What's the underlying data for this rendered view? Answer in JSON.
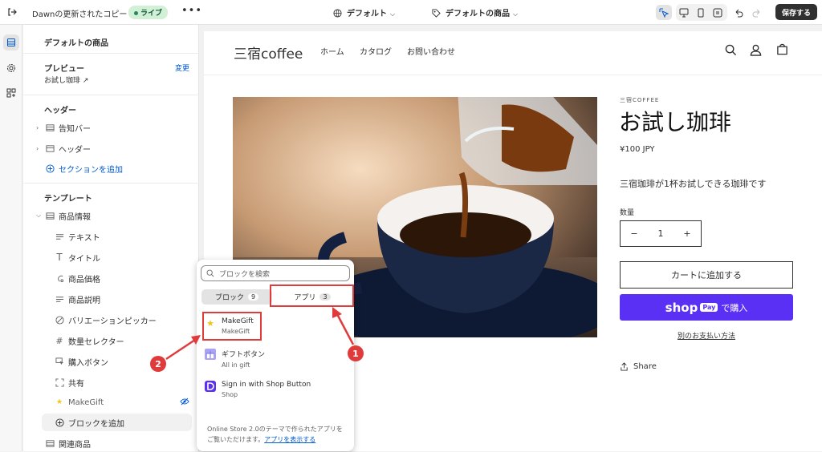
{
  "topbar": {
    "theme_name": "Dawnの更新されたコピー",
    "live_badge": "ライブ",
    "more_label": "•••",
    "template_select": "デフォルト",
    "product_select": "デフォルトの商品",
    "save_label": "保存する"
  },
  "sidebar": {
    "title": "デフォルトの商品",
    "preview_label": "プレビュー",
    "preview_change": "変更",
    "preview_item": "お試し珈琲",
    "header_section": "ヘッダー",
    "header_items": [
      {
        "label": "告知バー"
      },
      {
        "label": "ヘッダー"
      }
    ],
    "add_section": "セクションを追加",
    "template_section": "テンプレート",
    "product_info": "商品情報",
    "blocks": [
      {
        "label": "テキスト"
      },
      {
        "label": "タイトル"
      },
      {
        "label": "商品価格"
      },
      {
        "label": "商品説明"
      },
      {
        "label": "バリエーションピッカー"
      },
      {
        "label": "数量セレクター"
      },
      {
        "label": "購入ボタン"
      },
      {
        "label": "共有"
      },
      {
        "label": "MakeGift"
      }
    ],
    "add_block": "ブロックを追加",
    "related": "関連商品"
  },
  "store": {
    "logo": "三宿coffee",
    "nav": [
      "ホーム",
      "カタログ",
      "お問い合わせ"
    ],
    "vendor": "三宿COFFEE",
    "title": "お試し珈琲",
    "price": "¥100 JPY",
    "description": "三宿珈琲が1杯お試しできる珈琲です",
    "qty_label": "数量",
    "qty_minus": "−",
    "qty_value": "1",
    "qty_plus": "+",
    "add_to_cart": "カートに追加する",
    "shop_logo": "shop",
    "shop_pay": "Pay",
    "shop_buy": "で購入",
    "more_payment": "別のお支払い方法",
    "share": "Share"
  },
  "popover": {
    "search_placeholder": "ブロックを検索",
    "tab_blocks": "ブロック",
    "tab_blocks_count": "9",
    "tab_apps": "アプリ",
    "tab_apps_count": "3",
    "apps": [
      {
        "name": "MakeGift",
        "source": "MakeGift"
      },
      {
        "name": "ギフトボタン",
        "source": "All in gift"
      },
      {
        "name": "Sign in with Shop Button",
        "source": "Shop"
      }
    ],
    "footer_text": "Online Store 2.0のテーマで作られたアプリをご覧いただけます。",
    "footer_link": "アプリを表示する"
  },
  "annotations": {
    "one": "1",
    "two": "2"
  },
  "colors": {
    "accent": "#005bd3",
    "shop_purple": "#5a31f4",
    "annotation_red": "#e03b3b",
    "live_green": "#29845a"
  }
}
